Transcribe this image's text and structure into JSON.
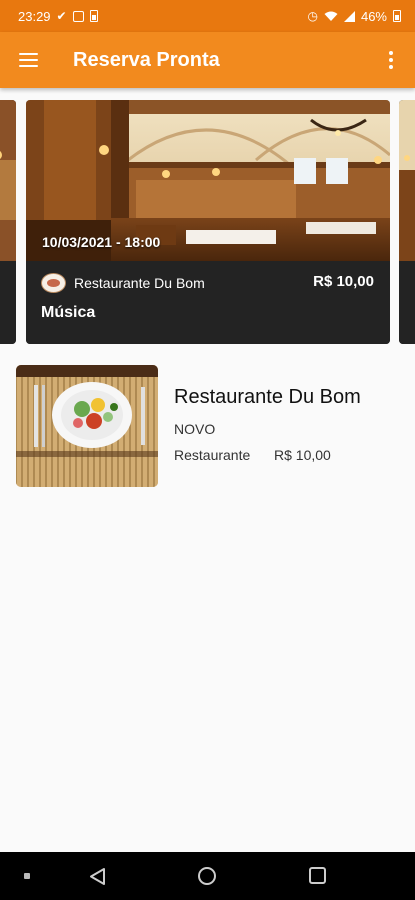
{
  "status_bar": {
    "time": "23:29",
    "battery": "46%",
    "left_icons": [
      "check-icon",
      "image-icon",
      "battery-saver-icon"
    ],
    "right_icons": [
      "alarm-icon",
      "wifi-icon",
      "signal-icon",
      "battery-icon"
    ]
  },
  "app_bar": {
    "title": "Reserva Pronta",
    "menu_icon": "hamburger-menu-icon",
    "more_icon": "more-vertical-icon",
    "color": "#f28a1e"
  },
  "events": [
    {
      "datetime": "10/03/2021 - 18:00",
      "venue": "Restaurante Du Bom",
      "price": "R$ 10,00",
      "name": "Música"
    }
  ],
  "places": [
    {
      "name": "Restaurante Du Bom",
      "badge": "NOVO",
      "category": "Restaurante",
      "price": "R$ 10,00"
    }
  ],
  "nav_bar": {
    "icons": [
      "nav-dot-icon",
      "back-icon",
      "home-icon",
      "recents-icon"
    ]
  }
}
